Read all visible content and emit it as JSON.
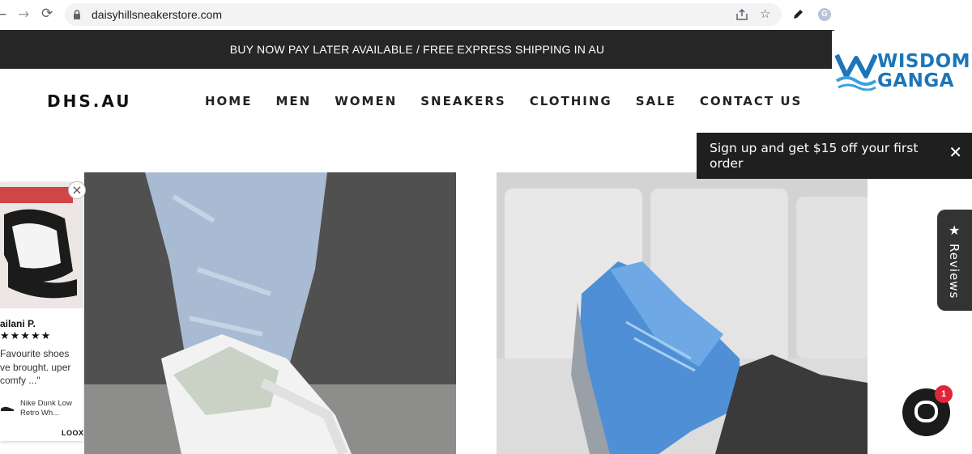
{
  "browser": {
    "back": "←",
    "forward": "→",
    "reload": "⟳",
    "url": "daisyhillsneakerstore.com",
    "share_icon": "share-icon",
    "star_icon": "bookmark-star-icon",
    "edit_icon": "pen-icon",
    "profile_letter": "G"
  },
  "announcement": "BUY NOW PAY LATER AVAILABLE / FREE EXPRESS SHIPPING IN AU",
  "header": {
    "logo": "DHS.AU",
    "menu": [
      "HOME",
      "MEN",
      "WOMEN",
      "SNEAKERS",
      "CLOTHING",
      "SALE",
      "CONTACT US"
    ]
  },
  "watermark": {
    "line1": "WISDOM",
    "line2": "GANGA"
  },
  "signup": {
    "text": "Sign up and get $15 off your first order",
    "close": "✕"
  },
  "review_popup": {
    "name": "ailani P.",
    "stars": "★★★★★",
    "quote": "Favourite shoes ve brought. uper comfy ...\"",
    "product": "Nike Dunk Low Retro Wh...",
    "brand": "LOOX",
    "close": "×"
  },
  "reviews_tab": {
    "label": "Reviews",
    "icon": "★"
  },
  "chat": {
    "badge": "1"
  },
  "colors": {
    "dark_bar": "#262626",
    "accent_blue": "#1d75b8",
    "badge_red": "#e0243a"
  }
}
